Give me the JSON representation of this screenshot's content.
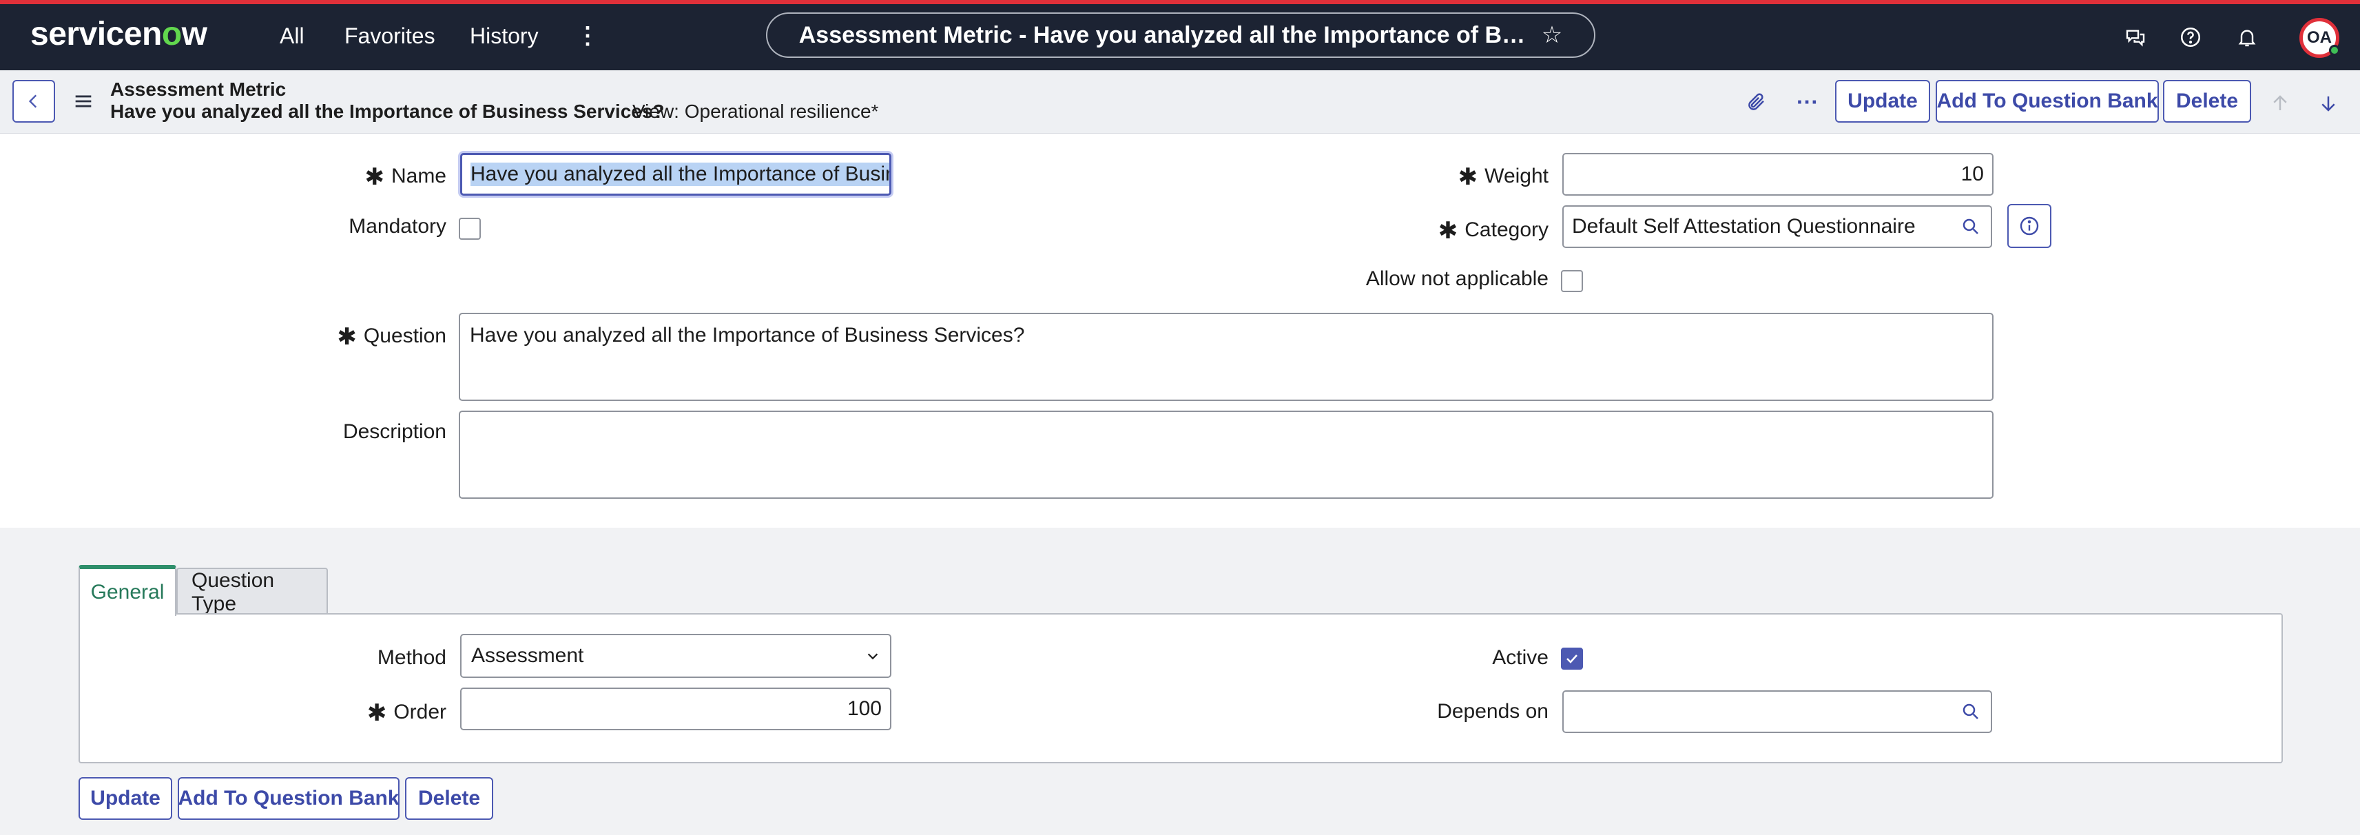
{
  "topnav": {
    "logo_pre": "servicen",
    "logo_o": "o",
    "logo_post": "w",
    "links": [
      "All",
      "Favorites",
      "History"
    ],
    "more": "⋮",
    "title": "Assessment Metric - Have you analyzed all the Importance of Business Se...",
    "star": "☆",
    "avatar_initials": "OA"
  },
  "header": {
    "table_name": "Assessment Metric",
    "record_name": "Have you analyzed all the Importance of Business Services?",
    "view": "View: Operational resilience*",
    "more": "···",
    "update_label": "Update",
    "add_to_bank_label": "Add To Question Bank",
    "delete_label": "Delete"
  },
  "form": {
    "required_mark": "✱",
    "name_label": "Name",
    "name_value": "Have you analyzed all the Importance of Business",
    "mandatory_label": "Mandatory",
    "weight_label": "Weight",
    "weight_value": "10",
    "category_label": "Category",
    "category_value": "Default Self Attestation Questionnaire",
    "allow_na_label": "Allow not applicable",
    "question_label": "Question",
    "question_value": "Have you analyzed all the Importance of Business Services?",
    "description_label": "Description",
    "description_value": ""
  },
  "tabs": {
    "items": [
      {
        "label": "General"
      },
      {
        "label": "Question Type"
      }
    ],
    "general": {
      "method_label": "Method",
      "method_value": "Assessment",
      "order_label": "Order",
      "order_value": "100",
      "active_label": "Active",
      "depends_label": "Depends on",
      "depends_value": ""
    }
  },
  "footer": {
    "update_label": "Update",
    "add_to_bank_label": "Add To Question Bank",
    "delete_label": "Delete"
  },
  "colors": {
    "nav_bg": "#1c2333",
    "accent_red": "#e0303a",
    "button_blue": "#4c59b2",
    "tab_green": "#2f8f6b"
  }
}
